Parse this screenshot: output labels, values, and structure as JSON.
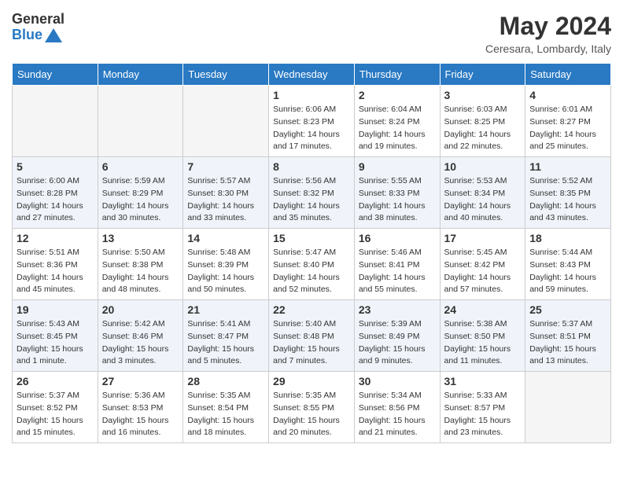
{
  "header": {
    "logo_general": "General",
    "logo_blue": "Blue",
    "month_year": "May 2024",
    "location": "Ceresara, Lombardy, Italy"
  },
  "days_of_week": [
    "Sunday",
    "Monday",
    "Tuesday",
    "Wednesday",
    "Thursday",
    "Friday",
    "Saturday"
  ],
  "weeks": [
    [
      {
        "day": "",
        "sunrise": "",
        "sunset": "",
        "daylight": ""
      },
      {
        "day": "",
        "sunrise": "",
        "sunset": "",
        "daylight": ""
      },
      {
        "day": "",
        "sunrise": "",
        "sunset": "",
        "daylight": ""
      },
      {
        "day": "1",
        "sunrise": "Sunrise: 6:06 AM",
        "sunset": "Sunset: 8:23 PM",
        "daylight": "Daylight: 14 hours and 17 minutes."
      },
      {
        "day": "2",
        "sunrise": "Sunrise: 6:04 AM",
        "sunset": "Sunset: 8:24 PM",
        "daylight": "Daylight: 14 hours and 19 minutes."
      },
      {
        "day": "3",
        "sunrise": "Sunrise: 6:03 AM",
        "sunset": "Sunset: 8:25 PM",
        "daylight": "Daylight: 14 hours and 22 minutes."
      },
      {
        "day": "4",
        "sunrise": "Sunrise: 6:01 AM",
        "sunset": "Sunset: 8:27 PM",
        "daylight": "Daylight: 14 hours and 25 minutes."
      }
    ],
    [
      {
        "day": "5",
        "sunrise": "Sunrise: 6:00 AM",
        "sunset": "Sunset: 8:28 PM",
        "daylight": "Daylight: 14 hours and 27 minutes."
      },
      {
        "day": "6",
        "sunrise": "Sunrise: 5:59 AM",
        "sunset": "Sunset: 8:29 PM",
        "daylight": "Daylight: 14 hours and 30 minutes."
      },
      {
        "day": "7",
        "sunrise": "Sunrise: 5:57 AM",
        "sunset": "Sunset: 8:30 PM",
        "daylight": "Daylight: 14 hours and 33 minutes."
      },
      {
        "day": "8",
        "sunrise": "Sunrise: 5:56 AM",
        "sunset": "Sunset: 8:32 PM",
        "daylight": "Daylight: 14 hours and 35 minutes."
      },
      {
        "day": "9",
        "sunrise": "Sunrise: 5:55 AM",
        "sunset": "Sunset: 8:33 PM",
        "daylight": "Daylight: 14 hours and 38 minutes."
      },
      {
        "day": "10",
        "sunrise": "Sunrise: 5:53 AM",
        "sunset": "Sunset: 8:34 PM",
        "daylight": "Daylight: 14 hours and 40 minutes."
      },
      {
        "day": "11",
        "sunrise": "Sunrise: 5:52 AM",
        "sunset": "Sunset: 8:35 PM",
        "daylight": "Daylight: 14 hours and 43 minutes."
      }
    ],
    [
      {
        "day": "12",
        "sunrise": "Sunrise: 5:51 AM",
        "sunset": "Sunset: 8:36 PM",
        "daylight": "Daylight: 14 hours and 45 minutes."
      },
      {
        "day": "13",
        "sunrise": "Sunrise: 5:50 AM",
        "sunset": "Sunset: 8:38 PM",
        "daylight": "Daylight: 14 hours and 48 minutes."
      },
      {
        "day": "14",
        "sunrise": "Sunrise: 5:48 AM",
        "sunset": "Sunset: 8:39 PM",
        "daylight": "Daylight: 14 hours and 50 minutes."
      },
      {
        "day": "15",
        "sunrise": "Sunrise: 5:47 AM",
        "sunset": "Sunset: 8:40 PM",
        "daylight": "Daylight: 14 hours and 52 minutes."
      },
      {
        "day": "16",
        "sunrise": "Sunrise: 5:46 AM",
        "sunset": "Sunset: 8:41 PM",
        "daylight": "Daylight: 14 hours and 55 minutes."
      },
      {
        "day": "17",
        "sunrise": "Sunrise: 5:45 AM",
        "sunset": "Sunset: 8:42 PM",
        "daylight": "Daylight: 14 hours and 57 minutes."
      },
      {
        "day": "18",
        "sunrise": "Sunrise: 5:44 AM",
        "sunset": "Sunset: 8:43 PM",
        "daylight": "Daylight: 14 hours and 59 minutes."
      }
    ],
    [
      {
        "day": "19",
        "sunrise": "Sunrise: 5:43 AM",
        "sunset": "Sunset: 8:45 PM",
        "daylight": "Daylight: 15 hours and 1 minute."
      },
      {
        "day": "20",
        "sunrise": "Sunrise: 5:42 AM",
        "sunset": "Sunset: 8:46 PM",
        "daylight": "Daylight: 15 hours and 3 minutes."
      },
      {
        "day": "21",
        "sunrise": "Sunrise: 5:41 AM",
        "sunset": "Sunset: 8:47 PM",
        "daylight": "Daylight: 15 hours and 5 minutes."
      },
      {
        "day": "22",
        "sunrise": "Sunrise: 5:40 AM",
        "sunset": "Sunset: 8:48 PM",
        "daylight": "Daylight: 15 hours and 7 minutes."
      },
      {
        "day": "23",
        "sunrise": "Sunrise: 5:39 AM",
        "sunset": "Sunset: 8:49 PM",
        "daylight": "Daylight: 15 hours and 9 minutes."
      },
      {
        "day": "24",
        "sunrise": "Sunrise: 5:38 AM",
        "sunset": "Sunset: 8:50 PM",
        "daylight": "Daylight: 15 hours and 11 minutes."
      },
      {
        "day": "25",
        "sunrise": "Sunrise: 5:37 AM",
        "sunset": "Sunset: 8:51 PM",
        "daylight": "Daylight: 15 hours and 13 minutes."
      }
    ],
    [
      {
        "day": "26",
        "sunrise": "Sunrise: 5:37 AM",
        "sunset": "Sunset: 8:52 PM",
        "daylight": "Daylight: 15 hours and 15 minutes."
      },
      {
        "day": "27",
        "sunrise": "Sunrise: 5:36 AM",
        "sunset": "Sunset: 8:53 PM",
        "daylight": "Daylight: 15 hours and 16 minutes."
      },
      {
        "day": "28",
        "sunrise": "Sunrise: 5:35 AM",
        "sunset": "Sunset: 8:54 PM",
        "daylight": "Daylight: 15 hours and 18 minutes."
      },
      {
        "day": "29",
        "sunrise": "Sunrise: 5:35 AM",
        "sunset": "Sunset: 8:55 PM",
        "daylight": "Daylight: 15 hours and 20 minutes."
      },
      {
        "day": "30",
        "sunrise": "Sunrise: 5:34 AM",
        "sunset": "Sunset: 8:56 PM",
        "daylight": "Daylight: 15 hours and 21 minutes."
      },
      {
        "day": "31",
        "sunrise": "Sunrise: 5:33 AM",
        "sunset": "Sunset: 8:57 PM",
        "daylight": "Daylight: 15 hours and 23 minutes."
      },
      {
        "day": "",
        "sunrise": "",
        "sunset": "",
        "daylight": ""
      }
    ]
  ]
}
